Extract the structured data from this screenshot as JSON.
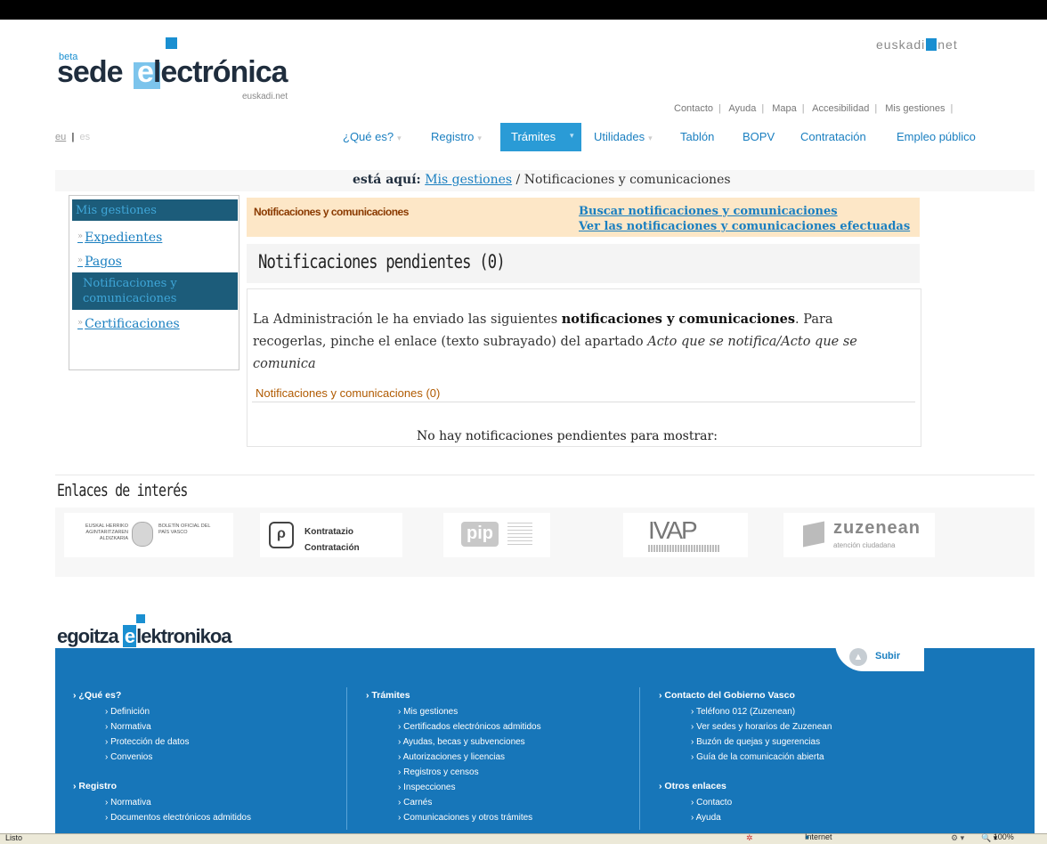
{
  "header": {
    "logo_beta": "beta",
    "logo_sede": "sede",
    "logo_elec": "lectrónica",
    "logo_sub": "euskadi.net",
    "euskadi_pre": "euskadi",
    "euskadi_post": "net"
  },
  "toplinks": [
    "Contacto",
    "Ayuda",
    "Mapa",
    "Accesibilidad",
    "Mis gestiones"
  ],
  "lang": {
    "eu": "eu",
    "es": "es"
  },
  "nav": {
    "items": [
      "¿Qué es?",
      "Registro",
      "Trámites",
      "Utilidades",
      "Tablón",
      "BOPV",
      "Contratación",
      "Empleo público"
    ],
    "active": "Trámites"
  },
  "breadcrumb": {
    "prefix": "está aquí:",
    "link": "Mis gestiones",
    "current": "/ Notificaciones y comunicaciones"
  },
  "sidebar": {
    "title": "Mis gestiones",
    "items": [
      {
        "label": "Expedientes"
      },
      {
        "label": "Pagos"
      },
      {
        "label": "Notificaciones y comunicaciones"
      },
      {
        "label": "Certificaciones"
      }
    ]
  },
  "main": {
    "bar_title": "Notificaciones y comunicaciones",
    "link_search": "Buscar notificaciones y comunicaciones",
    "link_done": "Ver las notificaciones y comunicaciones efectuadas",
    "heading": "Notificaciones pendientes (0)",
    "para_1": "La Administración le ha enviado las siguientes ",
    "para_bold": "notificaciones y comunicaciones",
    "para_2": ". Para recogerlas, pinche el enlace (texto subrayado) del apartado ",
    "para_italic": "Acto que se notifica/Acto que se comunica",
    "section_title": "Notificaciones y comunicaciones (0)",
    "empty": "No hay notificaciones pendientes para mostrar:"
  },
  "links_interest": {
    "title": "Enlaces de interés",
    "logos": [
      {
        "name": "EUSKAL HERRIKO AGINTARITZAREN ALDIZKARIA",
        "text2": "BOLETÍN OFICIAL DEL PAÍS VASCO"
      },
      {
        "name": "Kontratazio",
        "text2": "Contratación"
      },
      {
        "name": "pip"
      },
      {
        "name": "IVAP"
      },
      {
        "name": "zuzenean",
        "text2": "atención ciudadana"
      }
    ]
  },
  "footer": {
    "logo_pre": "egoitza ",
    "logo_e": "e",
    "logo_post": "lektronikoa",
    "subir": "Subir",
    "col1": {
      "h1": "¿Qué es?",
      "items1": [
        "Definición",
        "Normativa",
        "Protección de datos",
        "Convenios"
      ],
      "h2": "Registro",
      "items2": [
        "Normativa",
        "Documentos electrónicos admitidos"
      ]
    },
    "col2": {
      "h1": "Trámites",
      "items1": [
        "Mis gestiones",
        "Certificados electrónicos admitidos",
        "Ayudas, becas y subvenciones",
        "Autorizaciones y licencias",
        "Registros y censos",
        "Inspecciones",
        "Carnés",
        "Comunicaciones y otros trámites"
      ]
    },
    "col3": {
      "h1": "Contacto del Gobierno Vasco",
      "items1": [
        "Teléfono 012 (Zuzenean)",
        "Ver sedes y horarios de Zuzenean",
        "Buzón de quejas y sugerencias",
        "Guía de la comunicación abierta"
      ],
      "h2": "Otros enlaces",
      "items2": [
        "Contacto",
        "Ayuda"
      ]
    }
  },
  "statusbar": {
    "left": "Listo",
    "zone": "Internet",
    "zoom": "100%"
  },
  "colors": {
    "accent": "#1a8fd1",
    "nav_active": "#2a9bd6",
    "footer": "#1776b9",
    "sidebar_active": "#1c5c7a",
    "orange_bar": "#fde7c7"
  }
}
